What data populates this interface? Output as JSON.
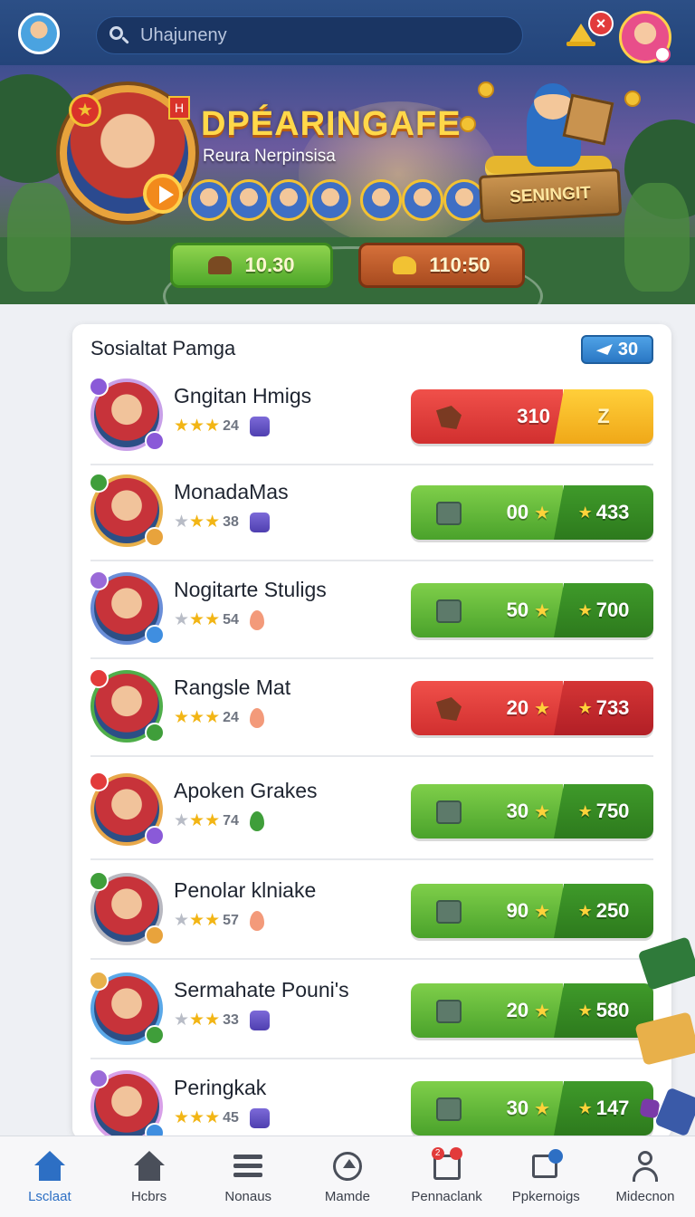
{
  "search": {
    "placeholder": "Uhajuneny"
  },
  "banner": {
    "title": "DPÉARINGAFE",
    "subtitle": "Reura Nerpinsisa",
    "crate_label": "SENINGIT",
    "rewards": [
      {
        "value": "10.30",
        "style": "green"
      },
      {
        "value": "110:50",
        "style": "orange"
      }
    ]
  },
  "card": {
    "title": "Sosialtat Pamga",
    "badge_value": "30",
    "rows": [
      {
        "name": "Gngitan Hmigs",
        "stars": 3,
        "rating": "24",
        "tag": "purple",
        "pill": "redgold",
        "left_value": "310",
        "right_value": "Z",
        "left_star": false,
        "right_star": false
      },
      {
        "name": "MonadaMas",
        "stars": 2,
        "rating": "38",
        "tag": "purple",
        "pill": "green",
        "left_value": "00",
        "right_value": "433",
        "left_star": true,
        "right_star": true
      },
      {
        "name": "Nogitarte Stuligs",
        "stars": 2,
        "rating": "54",
        "tag": "drop",
        "pill": "green",
        "left_value": "50",
        "right_value": "700",
        "left_star": true,
        "right_star": true
      },
      {
        "name": "Rangsle Mat",
        "stars": 3,
        "rating": "24",
        "tag": "drop",
        "pill": "red",
        "left_value": "20",
        "right_value": "733",
        "left_star": true,
        "right_star": true
      },
      {
        "name": "Apoken Grakes",
        "stars": 2,
        "rating": "74",
        "tag": "leaf",
        "pill": "green",
        "left_value": "30",
        "right_value": "750",
        "left_star": true,
        "right_star": true
      },
      {
        "name": "Penolar klniake",
        "stars": 2,
        "rating": "57",
        "tag": "drop",
        "pill": "green",
        "left_value": "90",
        "right_value": "250",
        "left_star": true,
        "right_star": true
      },
      {
        "name": "Sermahate Pouni's",
        "stars": 2,
        "rating": "33",
        "tag": "purple",
        "pill": "green",
        "left_value": "20",
        "right_value": "580",
        "left_star": true,
        "right_star": true
      },
      {
        "name": "Peringkak",
        "stars": 3,
        "rating": "45",
        "tag": "purple",
        "pill": "green",
        "left_value": "30",
        "right_value": "147",
        "left_star": true,
        "right_star": true
      }
    ]
  },
  "nav": [
    {
      "label": "Lsclaat",
      "icon": "home-icon",
      "active": true
    },
    {
      "label": "Hcbrs",
      "icon": "home-icon",
      "active": false
    },
    {
      "label": "Nonaus",
      "icon": "menu-icon",
      "active": false
    },
    {
      "label": "Mamde",
      "icon": "upload-circle-icon",
      "active": false
    },
    {
      "label": "Pennaclank",
      "icon": "calendar-icon",
      "active": false
    },
    {
      "label": "Ppkernoigs",
      "icon": "edit-icon",
      "active": false
    },
    {
      "label": "Midecnon",
      "icon": "user-icon",
      "active": false
    }
  ],
  "colors": {
    "topbar": "#23447a",
    "accent": "#2d6fc4",
    "gold": "#ffd84a"
  }
}
